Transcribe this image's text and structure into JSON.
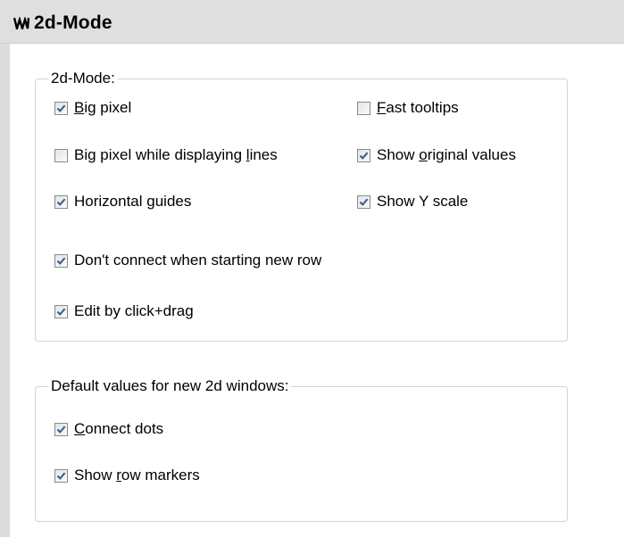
{
  "header": {
    "title": "2d-Mode",
    "icon": "waveform-icon"
  },
  "groups": [
    {
      "title": "2d-Mode:",
      "items": [
        {
          "id": "big-pixel",
          "pre": "",
          "acc": "B",
          "post": "ig pixel",
          "checked": true
        },
        {
          "id": "fast-tooltips",
          "pre": "",
          "acc": "F",
          "post": "ast tooltips",
          "checked": false
        },
        {
          "id": "big-pixel-lines",
          "pre": "Big pixel while displaying ",
          "acc": "l",
          "post": "ines",
          "checked": false
        },
        {
          "id": "show-original-values",
          "pre": "Show ",
          "acc": "o",
          "post": "riginal values",
          "checked": true
        },
        {
          "id": "horizontal-guides",
          "pre": "Horizontal guides",
          "acc": "",
          "post": "",
          "checked": true
        },
        {
          "id": "show-y-scale",
          "pre": "Show Y scale",
          "acc": "",
          "post": "",
          "checked": true
        },
        {
          "id": "dont-connect",
          "pre": "Don't connect when starting new row",
          "acc": "",
          "post": "",
          "checked": true
        },
        {
          "id": "edit-click-drag",
          "pre": "Edit by click+drag",
          "acc": "",
          "post": "",
          "checked": true
        }
      ]
    },
    {
      "title": "Default values for new 2d windows:",
      "items": [
        {
          "id": "connect-dots",
          "pre": "",
          "acc": "C",
          "post": "onnect dots",
          "checked": true
        },
        {
          "id": "show-row-markers",
          "pre": "Show ",
          "acc": "r",
          "post": "ow markers",
          "checked": true
        }
      ]
    }
  ],
  "colors": {
    "header_bg": "#dfdfdf",
    "group_border": "#cdd3dd",
    "check_mark": "#3a5a8c"
  }
}
